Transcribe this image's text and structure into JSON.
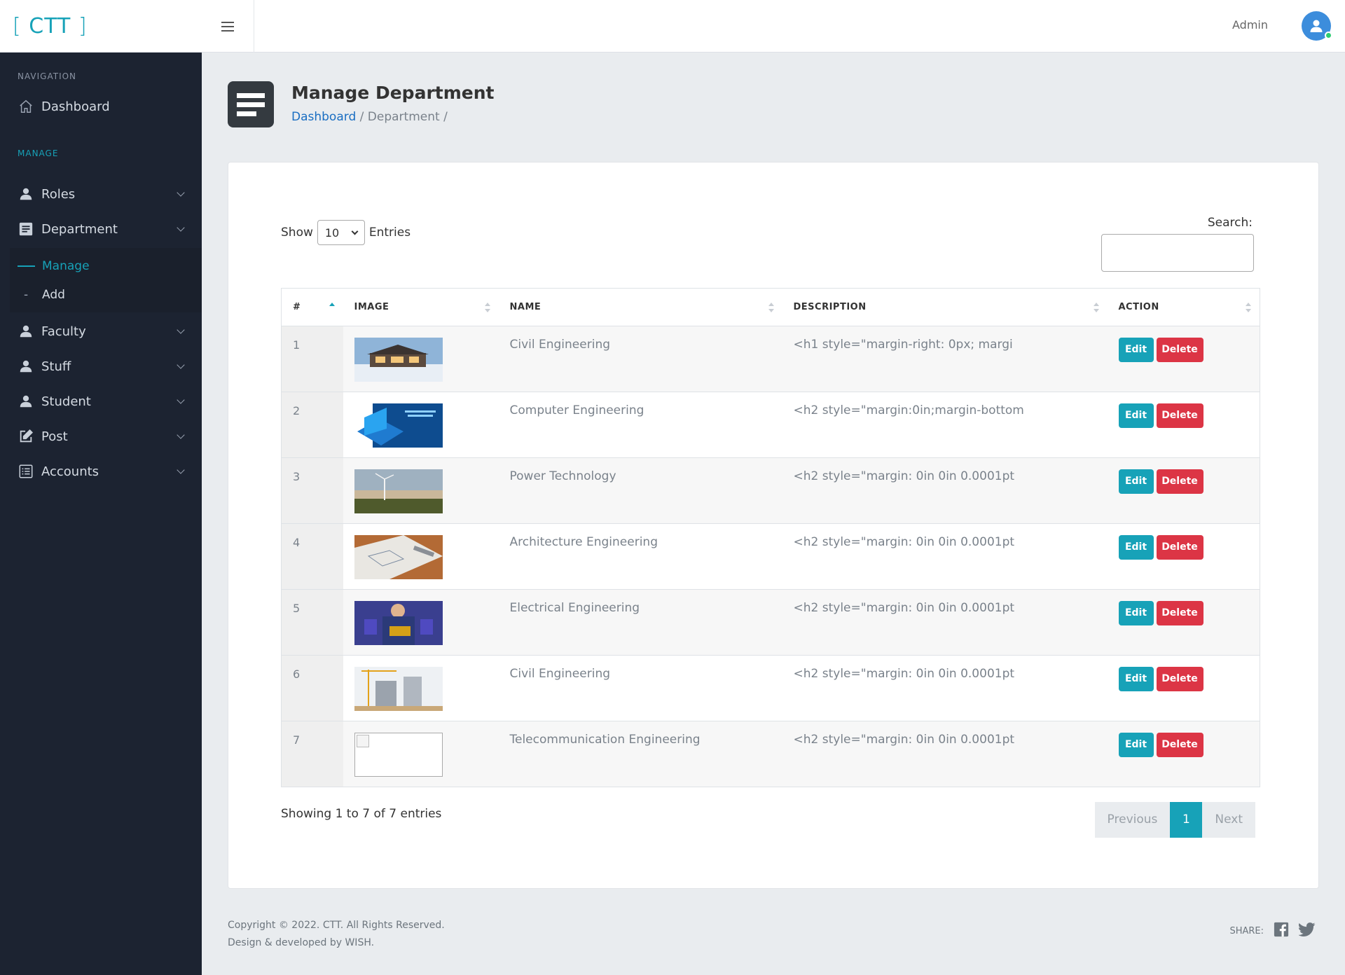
{
  "app": {
    "logo": "CTT"
  },
  "header": {
    "user": "Admin"
  },
  "sidebar": {
    "section_navigation": "NAVIGATION",
    "dashboard": "Dashboard",
    "section_manage": "MANAGE",
    "items": [
      {
        "label": "Roles",
        "icon": "user-icon"
      },
      {
        "label": "Department",
        "icon": "document-icon"
      },
      {
        "label": "Faculty",
        "icon": "user-icon"
      },
      {
        "label": "Stuff",
        "icon": "user-icon"
      },
      {
        "label": "Student",
        "icon": "user-icon"
      },
      {
        "label": "Post",
        "icon": "edit-icon"
      },
      {
        "label": "Accounts",
        "icon": "list-icon"
      }
    ],
    "department_sub": [
      {
        "label": "Manage",
        "active": true
      },
      {
        "label": "Add",
        "active": false
      }
    ]
  },
  "page": {
    "title": "Manage Department",
    "breadcrumb": {
      "home": "Dashboard",
      "sep": "/",
      "current": "Department",
      "trailing": "/"
    }
  },
  "table_controls": {
    "show": "Show",
    "entries_value": "10",
    "entries": "Entries",
    "search_label": "Search:"
  },
  "table": {
    "columns": [
      "#",
      "IMAGE",
      "NAME",
      "DESCRIPTION",
      "ACTION"
    ],
    "rows": [
      {
        "id": "1",
        "name": "Civil Engineering",
        "description": "<h1 style=\"margin-right: 0px; margi",
        "image": "house"
      },
      {
        "id": "2",
        "name": "Computer Engineering",
        "description": "<h2 style=\"margin:0in;margin-bottom",
        "image": "computer"
      },
      {
        "id": "3",
        "name": "Power Technology",
        "description": "<h2 style=\"margin: 0in 0in 0.0001pt",
        "image": "wind"
      },
      {
        "id": "4",
        "name": "Architecture Engineering",
        "description": "<h2 style=\"margin: 0in 0in 0.0001pt",
        "image": "blueprint"
      },
      {
        "id": "5",
        "name": "Electrical Engineering",
        "description": "<h2 style=\"margin: 0in 0in 0.0001pt",
        "image": "circuit"
      },
      {
        "id": "6",
        "name": "Civil Engineering",
        "description": "<h2 style=\"margin: 0in 0in 0.0001pt",
        "image": "construction"
      },
      {
        "id": "7",
        "name": "Telecommunication Engineering",
        "description": "<h2 style=\"margin: 0in 0in 0.0001pt",
        "image": "broken"
      }
    ],
    "edit_label": "Edit",
    "delete_label": "Delete"
  },
  "pagination": {
    "info": "Showing 1 to 7 of 7 entries",
    "previous": "Previous",
    "current": "1",
    "next": "Next"
  },
  "footer": {
    "copyright": "Copyright © 2022. CTT. All Rights Reserved.",
    "developed": "Design & developed by WISH.",
    "share": "SHARE:"
  },
  "colors": {
    "accent": "#17a2b8",
    "danger": "#dc3545",
    "sidebar": "#1c2331",
    "link": "#1a6ec2"
  }
}
